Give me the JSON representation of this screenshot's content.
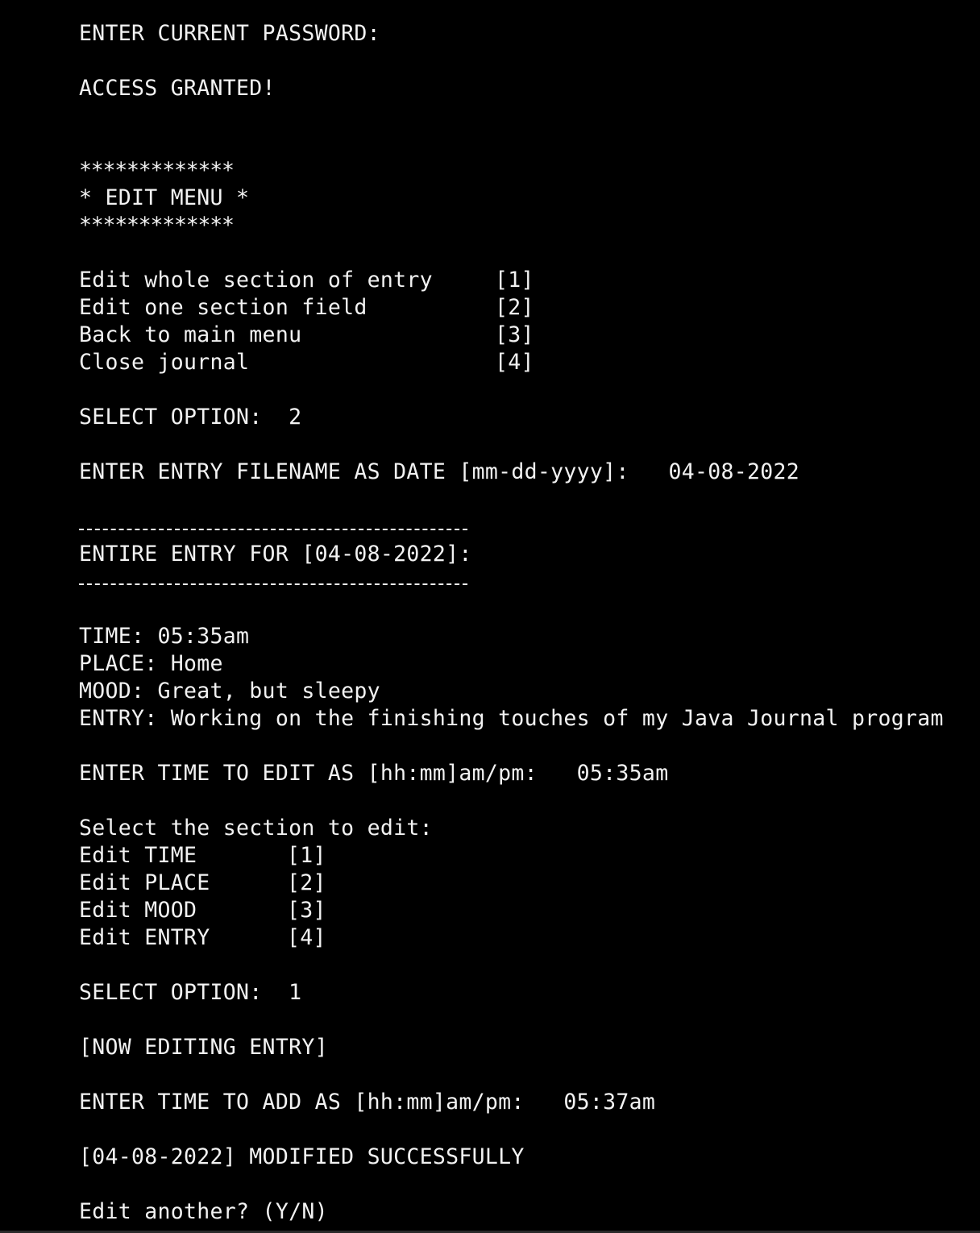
{
  "password_prompt": "ENTER CURRENT PASSWORD:",
  "access_message": "ACCESS GRANTED!",
  "edit_menu": {
    "border_top": "*************",
    "title": "* EDIT MENU *",
    "border_bottom": "*************",
    "options": [
      {
        "label": "Edit whole section of entry",
        "key": "[1]"
      },
      {
        "label": "Edit one section field",
        "key": "[2]"
      },
      {
        "label": "Back to main menu",
        "key": "[3]"
      },
      {
        "label": "Close journal",
        "key": "[4]"
      }
    ],
    "select_prompt": "SELECT OPTION:  2"
  },
  "filename_prompt": "ENTER ENTRY FILENAME AS DATE [mm-dd-yyyy]:   04-08-2022",
  "entry_header": "ENTIRE ENTRY FOR [04-08-2022]:",
  "entry": {
    "time": "TIME: 05:35am",
    "place": "PLACE: Home",
    "mood": "MOOD: Great, but sleepy",
    "text": "ENTRY: Working on the finishing touches of my Java Journal program"
  },
  "time_edit_prompt": "ENTER TIME TO EDIT AS [hh:mm]am/pm:   05:35am",
  "section_menu": {
    "heading": "Select the section to edit:",
    "options": [
      {
        "label": "Edit TIME",
        "key": "[1]"
      },
      {
        "label": "Edit PLACE",
        "key": "[2]"
      },
      {
        "label": "Edit MOOD",
        "key": "[3]"
      },
      {
        "label": "Edit ENTRY",
        "key": "[4]"
      }
    ],
    "select_prompt": "SELECT OPTION:  1"
  },
  "now_editing": "[NOW EDITING ENTRY]",
  "time_add_prompt": "ENTER TIME TO ADD AS [hh:mm]am/pm:   05:37am",
  "modified_message": "[04-08-2022] MODIFIED SUCCESSFULLY",
  "edit_another_prompt": "Edit another? (Y/N)",
  "colors": {
    "background": "#000000",
    "text": "#f2f2f2"
  }
}
